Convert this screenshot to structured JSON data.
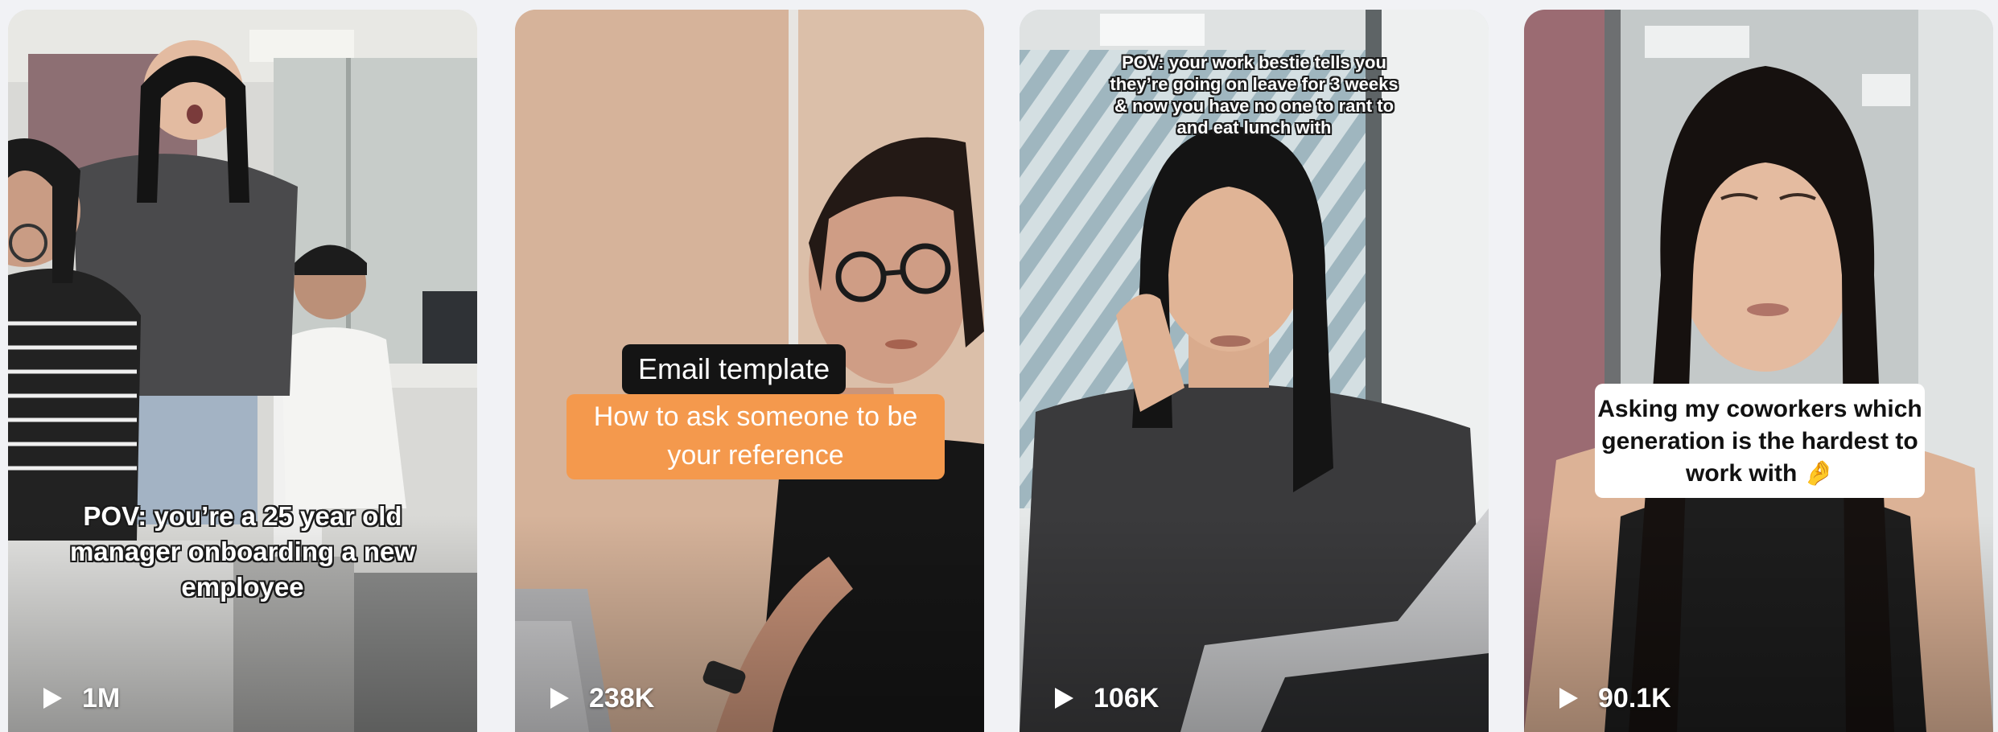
{
  "videos": [
    {
      "caption": "POV: you’re a 25 year old manager onboarding a new employee",
      "views": "1M"
    },
    {
      "caption_title": "Email template",
      "caption_body": "How to ask someone to be your reference",
      "views": "238K"
    },
    {
      "caption": "POV: your work bestie tells you they’re going on leave for 3 weeks & now you have no one to rant to and eat lunch with",
      "views": "106K"
    },
    {
      "caption": "Asking my coworkers which generation is the hardest to work with 🤌",
      "views": "90.1K"
    }
  ],
  "icons": {
    "views": "play-icon"
  }
}
